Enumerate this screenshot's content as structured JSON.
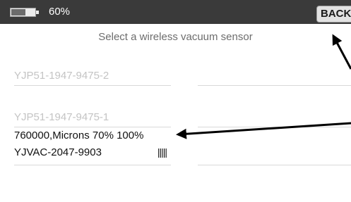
{
  "status_bar": {
    "battery_percent_text": "60%",
    "battery_level": 0.6,
    "back_label": "BACK"
  },
  "page": {
    "title": "Select a wireless vacuum sensor"
  },
  "sensors": [
    {
      "name": "YJP51-1947-9475-2",
      "state": "inactive"
    },
    {
      "name": "YJP51-1947-9475-1",
      "state": "inactive"
    },
    {
      "reading": "760000,Microns 70% 100%",
      "name": "YJVAC-2047-9903",
      "signal": "|||||",
      "state": "active"
    }
  ],
  "colors": {
    "status_bar_bg": "#3a3a3a",
    "inactive_text": "#c4c4c4",
    "active_text": "#111111",
    "title_text": "#6d6d6d"
  }
}
